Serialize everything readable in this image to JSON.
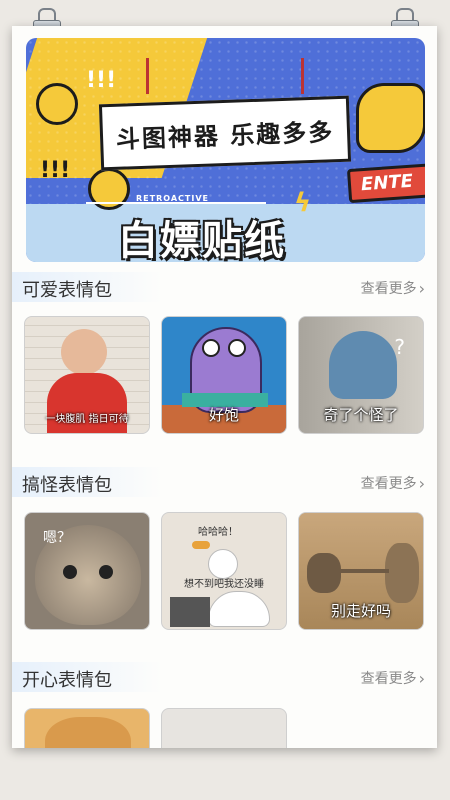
{
  "banner": {
    "sign_text": "斗图神器 乐趣多多",
    "retro_label": "RETROACTIVE",
    "title": "白嫖贴纸",
    "enter_label": "ENTE",
    "excl_a": "!!!",
    "excl_b": "!!!"
  },
  "sections": [
    {
      "title": "可爱表情包",
      "more": "查看更多",
      "cards": [
        {
          "caption": "一块腹肌 指日可待"
        },
        {
          "caption": "好饱"
        },
        {
          "caption": "奇了个怪了"
        }
      ]
    },
    {
      "title": "搞怪表情包",
      "more": "查看更多",
      "cards": [
        {
          "caption": "嗯？"
        },
        {
          "caption": "想不到吧我还没睡",
          "top": "哈哈哈！"
        },
        {
          "caption": "别走好吗"
        }
      ]
    },
    {
      "title": "开心表情包",
      "more": "查看更多",
      "cards": [
        {
          "caption": ""
        },
        {
          "caption": ""
        },
        {
          "caption": ""
        }
      ]
    }
  ],
  "colors": {
    "banner_blue": "#4f6fd8",
    "banner_yellow": "#f5c93a",
    "enter_red": "#e14a3b"
  }
}
